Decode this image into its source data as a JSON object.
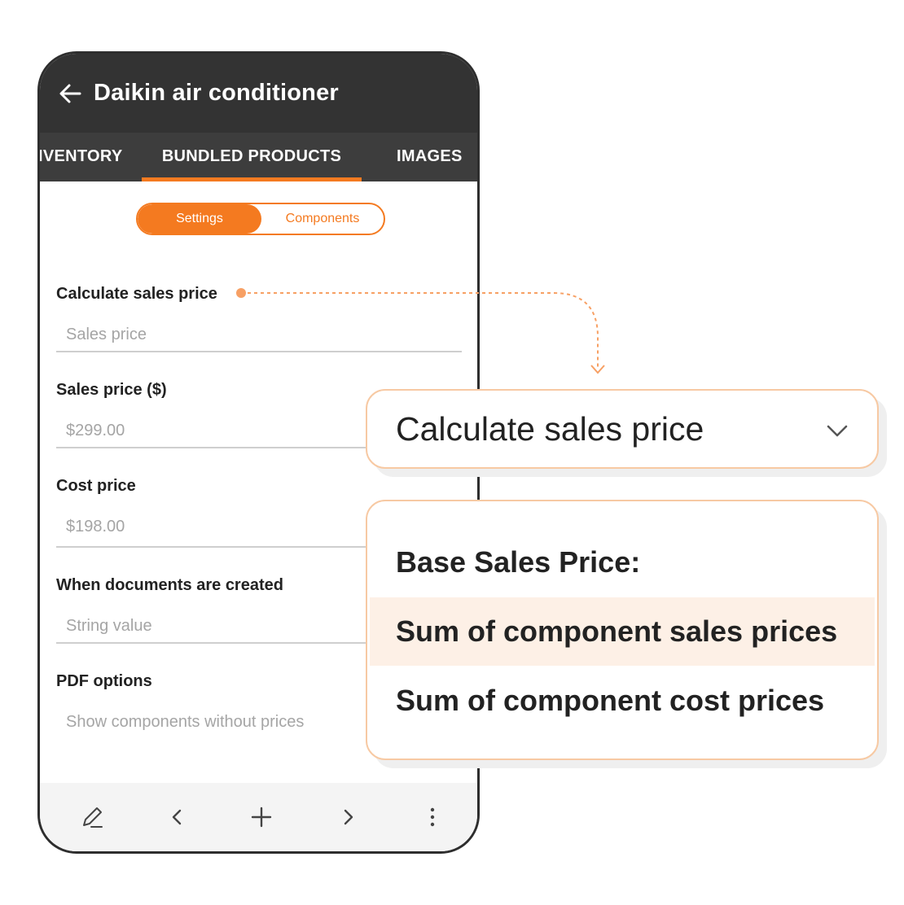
{
  "app": {
    "title": "Daikin air conditioner"
  },
  "tabs": [
    {
      "label": "IVENTORY",
      "active": false
    },
    {
      "label": "BUNDLED PRODUCTS",
      "active": true
    },
    {
      "label": "IMAGES",
      "active": false
    }
  ],
  "segmented": {
    "left": "Settings",
    "right": "Components",
    "selected": "Settings"
  },
  "fields": [
    {
      "label": "Calculate sales price",
      "value": "Sales price"
    },
    {
      "label": "Sales price ($)",
      "value": "$299.00"
    },
    {
      "label": "Cost price",
      "value": "$198.00"
    },
    {
      "label": "When documents are created",
      "value": "String value"
    },
    {
      "label": "PDF options",
      "value": "Show components without prices"
    }
  ],
  "bottom_bar": {
    "icons": [
      "pencil-icon",
      "chevron-left-icon",
      "plus-icon",
      "chevron-right-icon",
      "more-vertical-icon"
    ]
  },
  "dropdown": {
    "label": "Calculate sales price",
    "heading": "Base Sales Price:",
    "options": [
      {
        "label": "Sum of component sales prices",
        "highlighted": true
      },
      {
        "label": "Sum of component cost prices",
        "highlighted": false
      }
    ]
  },
  "colors": {
    "accent": "#f47a20",
    "appbar": "#333333",
    "highlight": "#fdf0e6",
    "card_border": "#f7c9a3"
  }
}
